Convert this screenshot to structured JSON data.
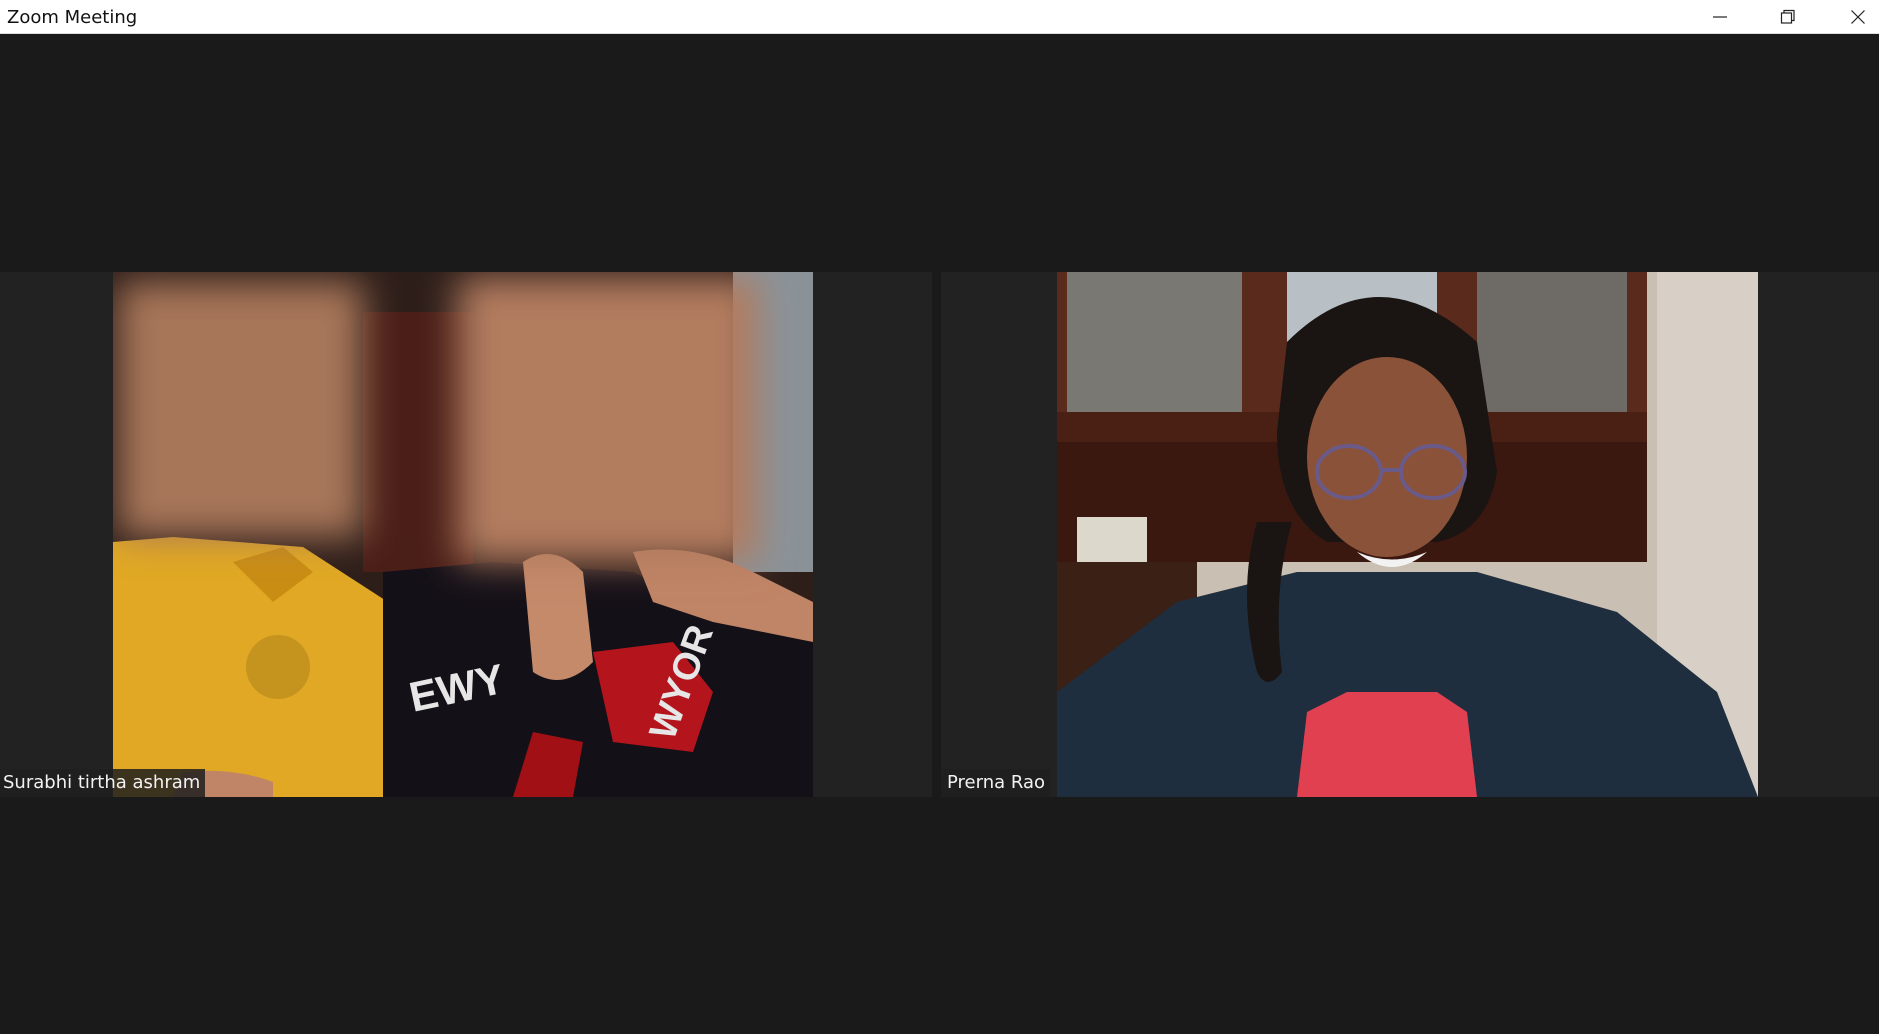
{
  "window": {
    "title": "Zoom Meeting",
    "buttons": {
      "minimize_icon": "minimize-icon",
      "restore_icon": "restore-icon",
      "close_icon": "close-icon"
    }
  },
  "participants": [
    {
      "name": "Surabhi tirtha ashram"
    },
    {
      "name": "Prerna Rao"
    }
  ],
  "colors": {
    "background": "#1a1a1a",
    "titlebar": "#ffffff",
    "name_label_bg": "#1e1e1e",
    "name_label_text": "#f2f2f2"
  }
}
